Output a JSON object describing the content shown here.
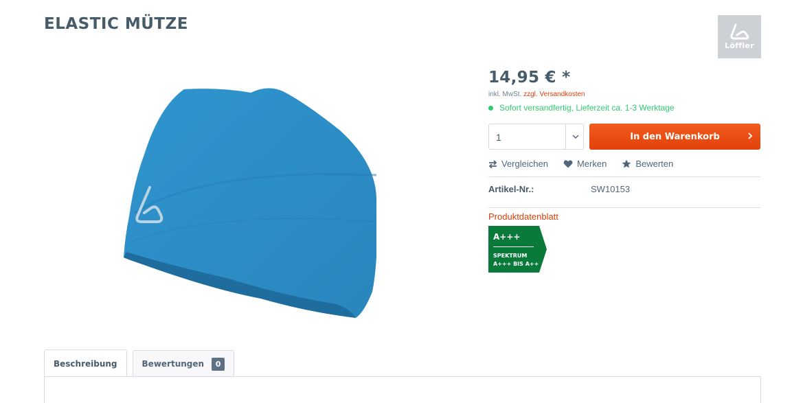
{
  "product": {
    "title": "ELASTIC MÜTZE",
    "brand": "Löffler",
    "image_alt": "blue-beanie"
  },
  "buybox": {
    "price": "14,95 € *",
    "tax_prefix": "inkl. MwSt.",
    "shipping_link": "zzgl. Versandkosten",
    "delivery_status": "Sofort versandfertig, Lieferzeit ca. 1-3 Werktage",
    "quantity": "1",
    "cart_button": "In den Warenkorb",
    "actions": {
      "compare": "Vergleichen",
      "remember": "Merken",
      "rate": "Bewerten"
    },
    "article_label": "Artikel-Nr.:",
    "article_value": "SW10153",
    "datasheet_link": "Produktdatenblatt",
    "energy": {
      "class": "A+++",
      "spectrum_line1": "SPEKTRUM",
      "spectrum_line2": "A+++ BIS A++"
    }
  },
  "tabs": [
    {
      "label": "Beschreibung",
      "active": true
    },
    {
      "label": "Bewertungen",
      "count": "0",
      "active": false
    }
  ],
  "colors": {
    "accent": "#e2420c",
    "success": "#2ecc71",
    "energy_green": "#0a7a3a",
    "text": "#475c6a",
    "hat_blue": "#2b8cc4"
  }
}
